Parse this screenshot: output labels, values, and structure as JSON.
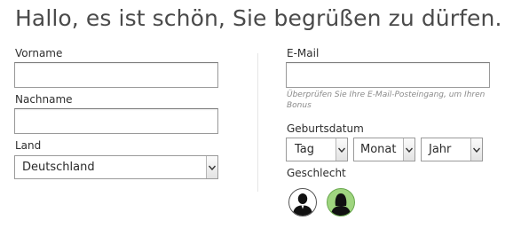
{
  "heading": "Hallo, es ist schön, Sie begrüßen zu dürfen.",
  "fields": {
    "vorname": {
      "label": "Vorname",
      "value": ""
    },
    "nachname": {
      "label": "Nachname",
      "value": ""
    },
    "land": {
      "label": "Land",
      "value": "Deutschland"
    },
    "email": {
      "label": "E-Mail",
      "value": "",
      "hint": "Überprüfen Sie Ihre E-Mail-Posteingang, um Ihren Bonus"
    },
    "geburtsdatum": {
      "label": "Geburtsdatum",
      "tag": "Tag",
      "monat": "Monat",
      "jahr": "Jahr"
    },
    "geschlecht": {
      "label": "Geschlecht",
      "options": [
        {
          "icon": "male-avatar-icon",
          "selected": false,
          "color": "#ffffff"
        },
        {
          "icon": "female-avatar-icon",
          "selected": true,
          "color": "#9fd57f"
        }
      ]
    }
  },
  "colors": {
    "border": "#9a9a9a",
    "selected_green": "#9fd57f",
    "hint_text": "#8a8a8a"
  }
}
